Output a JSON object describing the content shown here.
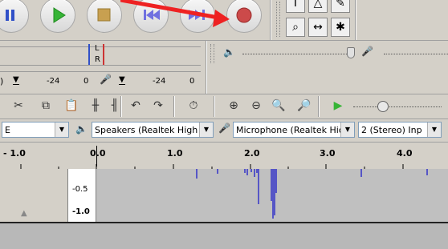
{
  "transport": {
    "pause_icon": "pause-icon",
    "play_icon": "play-icon",
    "stop_icon": "stop-icon",
    "skip_start_icon": "skip-to-start-icon",
    "skip_end_icon": "skip-to-end-icon",
    "record_icon": "record-icon"
  },
  "tools": [
    "I",
    "△",
    "✎",
    "⌕",
    "↔",
    "✱"
  ],
  "meters": {
    "record_channels": [
      "L",
      "R"
    ],
    "meter_scale": [
      "-24",
      "0",
      "-24",
      "0"
    ],
    "left_edge": ")"
  },
  "device_bar": {
    "host_value": "E",
    "output_device": "Speakers (Realtek High",
    "input_device": "Microphone (Realtek Hiç",
    "channels": "2 (Stereo) Inp"
  },
  "timeline": {
    "ticks": [
      "- 1.0",
      "0.0",
      "1.0",
      "2.0",
      "3.0",
      "4.0"
    ]
  },
  "track": {
    "scale_labels": [
      "-0.5",
      "-1.0"
    ]
  },
  "colors": {
    "background": "#d4d0c8",
    "record_red": "#cc4a4a",
    "play_green": "#36b436",
    "waveform_blue": "#3232c8",
    "track_gray": "#c0c0c0",
    "arrow_red": "#ee2222"
  }
}
